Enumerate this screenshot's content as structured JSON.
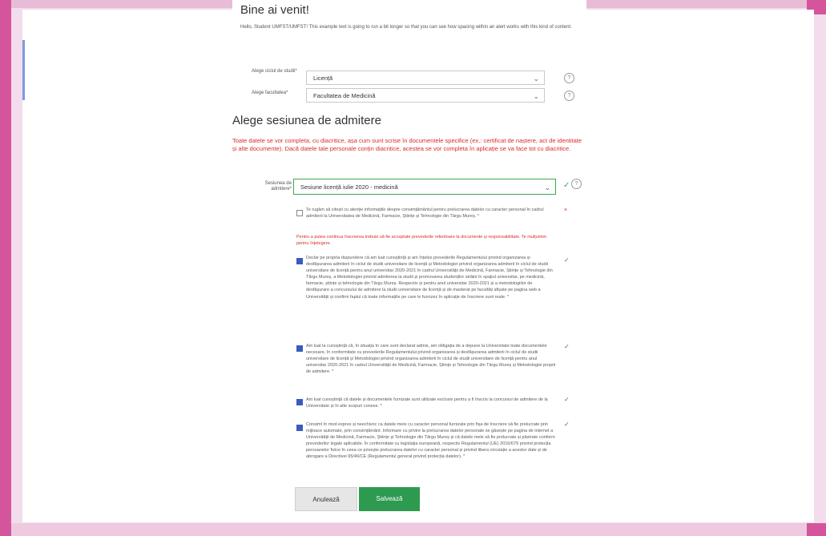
{
  "welcome": {
    "title": "Bine ai venit!",
    "intro": "Hello, Student UMFST/UMFST! This example text is going to run a bit longer so that you can see how spacing within an alert works with this kind of content."
  },
  "selects": [
    {
      "label": "Alege ciclul de studii*",
      "value": "Licență"
    },
    {
      "label": "Alege facultatea*",
      "value": "Facultatea de Medicină"
    }
  ],
  "session": {
    "title": "Alege sesiunea de admitere",
    "warning": "Toate datele se vor completa, cu diacritice, așa cum sunt scrise în documentele specifice (ex.: certificat de naștere, act de identitate și alte documente). Dacă datele tale personale conțin diacritice, acestea se vor completa în aplicație se va face tot cu diacritice.",
    "select_label": "Sesiunea de admitere*",
    "select_value": "Sesiune licență iulie 2020 - medicină"
  },
  "consents": [
    {
      "checked": false,
      "status": "×",
      "text": "Te rugăm să citești cu atenție informațiile despre consimțământul pentru prelucrarea datelor cu caracter personal în cadrul admiterii la Universitatea de Medicină, Farmacie, Științe și Tehnologie din Târgu Mureș. *",
      "note": "Pentru a putea continua înscrierea trebuie să fie acceptate prevederile referitoare la documente și responsabilitate. Te mulțumim pentru înțelegere."
    },
    {
      "checked": true,
      "status": "✓",
      "text": "Declar pe propria răspundere că am luat cunoștință și am înțeles prevederile Regulamentului privind organizarea și desfășurarea admiterii în ciclul de studii universitare de licență și Metodologiei privind organizarea admiterii în ciclul de studii universitare de licență pentru anul universitar 2020-2021 în cadrul Universității de Medicină, Farmacie, Științe și Tehnologie din Târgu Mureș, a Metodologiei privind admiterea la studii și promovarea studenților străini în spațiul universitar, pe medicină, farmacie, științe și tehnologie din Târgu Mureș. Respectiv și pentru anul universitar 2020-2021 și a metodologiilor de desfășurare a concursului de admitere la studii universitare de licență și de masterat pe facultăți afișate pe pagina web a Universității și confirm faptul că toate informațiile pe care le furnizez în aplicație de înscriere sunt reale. *"
    },
    {
      "checked": true,
      "status": "✓",
      "text": "Am luat la cunoștință că, în situația în care sunt declarat admis, am obligația de a depune la Universitate toate documentele necesare, în conformitate cu prevederile Regulamentului privind organizarea și desfășurarea admiterii în ciclul de studii universitare de licență și Metodologiei privind organizarea admiterii în ciclul de studii universitare de licență pentru anul universitar 2020-2021 în cadrul Universității de Medicină, Farmacie, Științe și Tehnologie din Târgu Mureș și Metodologiei proprii de admitere. *"
    },
    {
      "checked": true,
      "status": "✓",
      "text": "Am luat cunoștință că datele și documentele furnizate sunt utilizate exclusiv pentru a fi înscris la concursul de admitere de la Universitate și în alte scopuri conexe. *"
    },
    {
      "checked": true,
      "status": "✓",
      "text": "Consimt în mod expres și neechivoc ca datele mele cu caracter personal furnizate prin fișa de înscriere să fie prelucrate prin mijloace automate, prin consimțământ. Informare cu privire la prelucrarea datelor personale se găsește pe pagina de internet a Universității de Medicină, Farmacie, Științe și Tehnologie din Târgu Mureș și că datele mele să fie prelucrate și păstrate conform prevederilor legale aplicabile. În conformitate cu legislația europeană, respectiv Regulamentul (UE) 2016/679 privind protecția persoanelor fizice în ceea ce privește prelucrarea datelor cu caracter personal și privind libera circulație a acestor date și de abrogare a Directivei 95/46/CE (Regulamentul general privind protecția datelor). *"
    }
  ],
  "actions": {
    "cancel_label": "Anulează",
    "save_label": "Salvează"
  }
}
